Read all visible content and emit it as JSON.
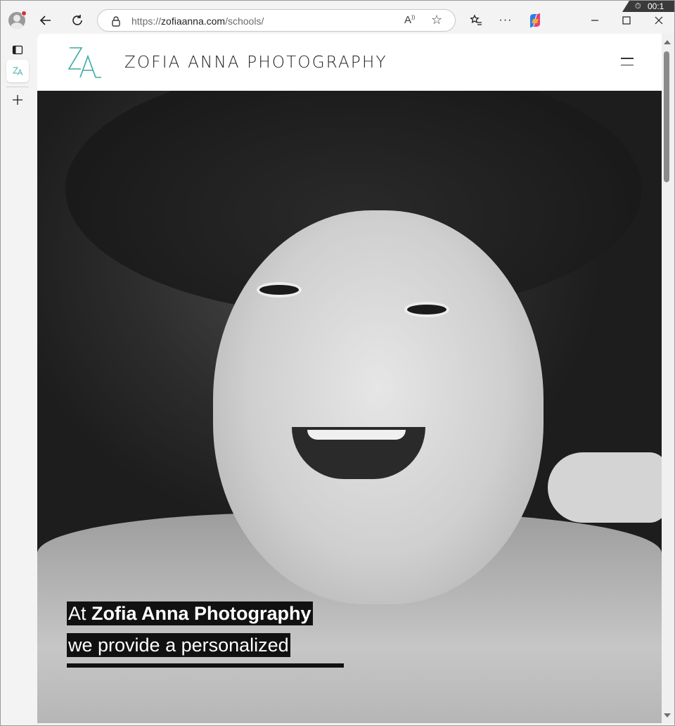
{
  "browser": {
    "url_prefix": "https://",
    "url_domain": "zofiaanna.com",
    "url_path": "/schools/",
    "time_badge": "00:1"
  },
  "site": {
    "logo_text": "ZA",
    "title": "ZOFIA ANNA PHOTOGRAPHY"
  },
  "hero": {
    "caption_line1_prefix": "At ",
    "caption_line1_bold": "Zofia Anna Photography",
    "caption_line2": "we provide a personalized"
  },
  "colors": {
    "logo_teal": "#3aa9a2",
    "caption_bg": "#111111"
  }
}
